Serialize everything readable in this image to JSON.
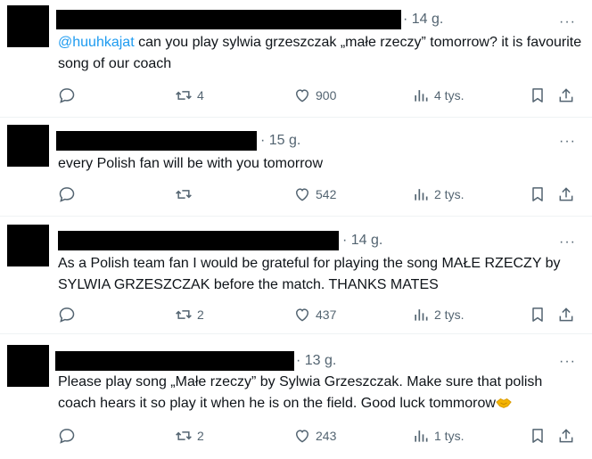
{
  "tweets": [
    {
      "time": "· 14 g.",
      "mention": "@huuhkajat",
      "text": " can you play sylwia grzeszczak „małe rzeczy” tomorrow? it is favourite song of our coach",
      "retweets": "4",
      "likes": "900",
      "views": "4 tys."
    },
    {
      "time": "· 15 g.",
      "mention": "",
      "text": "every Polish fan will be with you tomorrow",
      "retweets": "",
      "likes": "542",
      "views": "2 tys."
    },
    {
      "time": "· 14 g.",
      "mention": "",
      "text": "As a Polish team fan I would be grateful for playing the song MAŁE RZECZY by SYLWIA GRZESZCZAK before the match. THANKS MATES",
      "retweets": "2",
      "likes": "437",
      "views": "2 tys."
    },
    {
      "time": "· 13 g.",
      "mention": "",
      "text": "Please play song „Małe rzeczy” by Sylwia Grzeszczak. Make sure that polish coach hears it so play it when he is on the field. Good luck tommorow",
      "retweets": "2",
      "likes": "243",
      "views": "1 tys."
    }
  ],
  "more_label": "···",
  "icons": {
    "reply": "reply-icon",
    "retweet": "retweet-icon",
    "like": "heart-icon",
    "views": "views-icon",
    "bookmark": "bookmark-icon",
    "share": "share-icon",
    "emoji": "handshake-emoji-icon"
  },
  "colors": {
    "text": "#0f1419",
    "muted": "#536471",
    "link": "#1d9bf0",
    "border": "#eff3f4"
  }
}
